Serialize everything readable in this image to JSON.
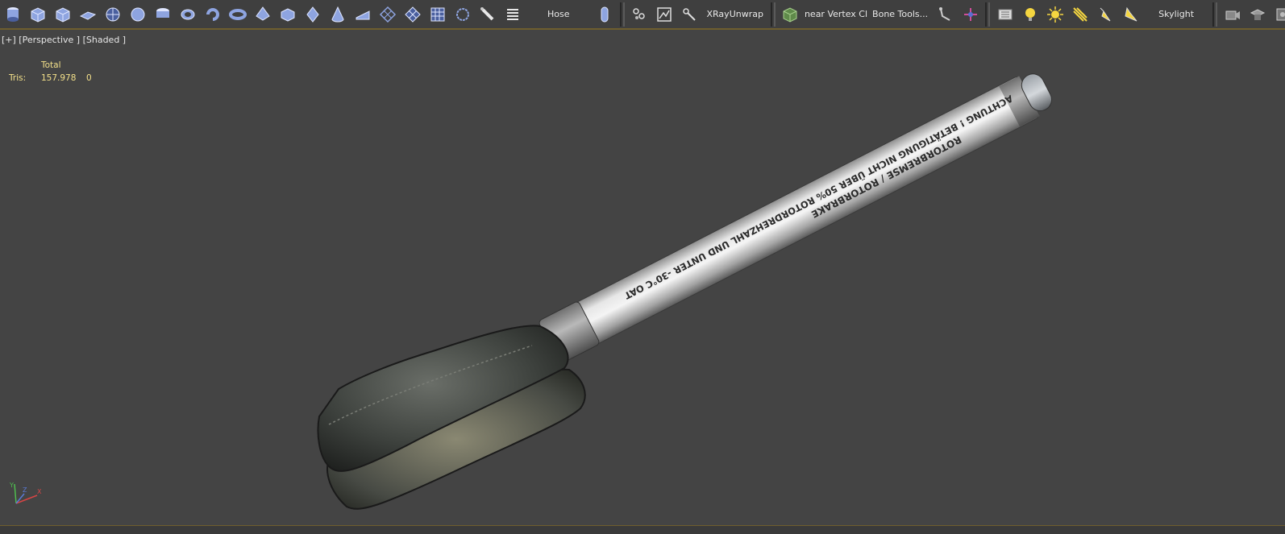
{
  "toolbar": {
    "shape_icons": [
      "cylinder-icon",
      "box-icon",
      "box-icon",
      "plane-icon",
      "geosphere-icon",
      "sphere-icon",
      "capsule-icon",
      "tube-icon",
      "torus-knot-icon",
      "torus-icon",
      "pyramid-icon",
      "chamfer-box-icon",
      "diamond-icon",
      "cone-icon",
      "wedge-icon",
      "lattice-icon",
      "grid-plane-icon",
      "grid-icon",
      "ring-icon",
      "spray-icon",
      "spring-icon"
    ],
    "hose_label": "Hose",
    "hose_icon": "hose-icon",
    "unwrap_icons": [
      "unwrap-icon",
      "uv-checker-icon",
      "unwrap-tool-icon"
    ],
    "xray_label": "XRayUnwrap",
    "vertex_icon": "vertex-cube-icon",
    "vertex_label": "near Vertex Cl",
    "bone_label": "Bone Tools...",
    "bone_icons": [
      "bone-icon",
      "bone-chain-icon"
    ],
    "light_icons": [
      "light-list-icon",
      "omni-light-icon",
      "sun-light-icon",
      "direct-light-icon",
      "spot-light-icon",
      "free-spot-light-icon"
    ],
    "skylight_label": "Skylight",
    "camera_icons": [
      "camera-icon",
      "target-camera-icon",
      "free-camera-icon"
    ]
  },
  "viewport": {
    "label": "[+] [Perspective ] [Shaded ]",
    "stats": {
      "header": "Total",
      "tris_label": "Tris:",
      "tris_total": "157.978",
      "tris_selected": "0"
    },
    "model_text_lines": [
      "ACHTUNG ! BETÄTIGUNG NICHT ÜBER 50% ROTORDREHZAHL UND UNTER -30°C OAT",
      "ROTORBREMSE / ROTORBRAKE"
    ]
  },
  "colors": {
    "viewport_bg": "#444444",
    "toolbar_bg": "#3f3f3f",
    "stats_text": "#f3e08a",
    "accent_border": "#6e5e2e",
    "icon_blue": "#8ea4e0"
  }
}
